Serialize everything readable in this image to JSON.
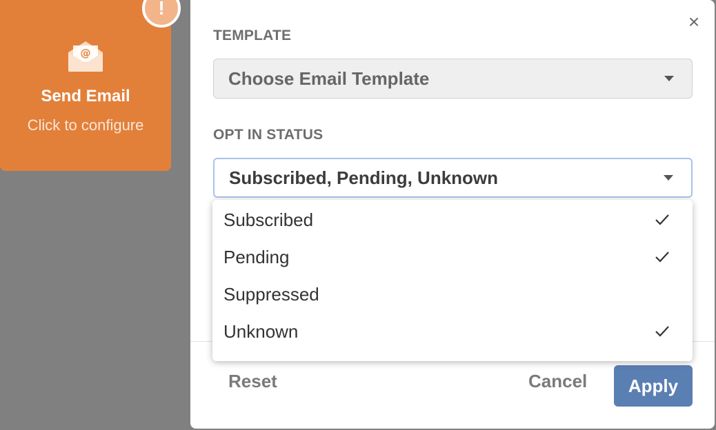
{
  "card": {
    "title": "Send Email",
    "subtitle": "Click to configure",
    "icon": "email-envelope-icon",
    "alert_icon": "exclamation-icon",
    "alert_glyph": "!",
    "color": "#e2803a"
  },
  "modal": {
    "close_glyph": "×",
    "template_label": "TEMPLATE",
    "template_placeholder": "Choose Email Template",
    "opt_label": "OPT IN STATUS",
    "opt_value": "Subscribed, Pending, Unknown",
    "reset_label": "Reset",
    "cancel_label": "Cancel",
    "apply_label": "Apply",
    "apply_color": "#5a7fb3"
  },
  "dropdown": {
    "options": [
      {
        "label": "Subscribed",
        "checked": true
      },
      {
        "label": "Pending",
        "checked": true
      },
      {
        "label": "Suppressed",
        "checked": false
      },
      {
        "label": "Unknown",
        "checked": true
      }
    ]
  }
}
